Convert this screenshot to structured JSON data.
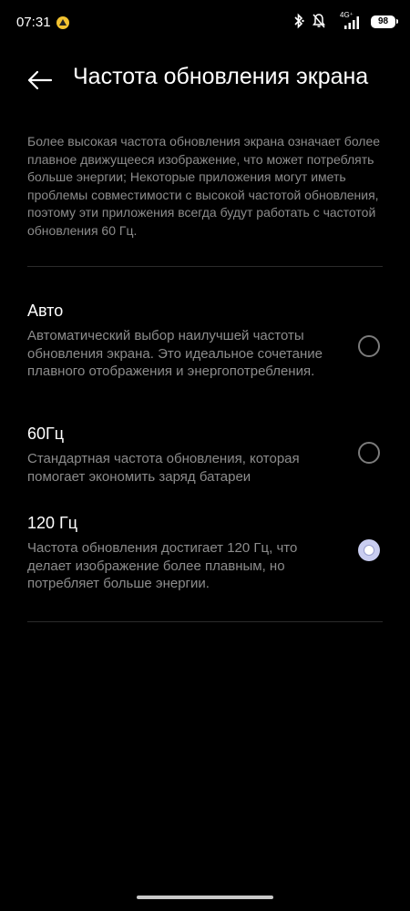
{
  "status_bar": {
    "time": "07:31",
    "network_type": "4G⁺",
    "battery": "98",
    "icons": [
      "app-notification-icon",
      "bluetooth-icon",
      "notifications-off-icon",
      "signal-icon",
      "battery-icon"
    ]
  },
  "header": {
    "back_icon": "back-arrow-icon",
    "title": "Частота обновления экрана"
  },
  "description": "Более высокая частота обновления экрана означает более плавное движущееся изображение, что может потреблять больше энергии; Некоторые приложения могут иметь проблемы совместимости с высокой частотой обновления, поэтому эти приложения всегда будут работать с частотой обновления 60 Гц.",
  "options": [
    {
      "title": "Авто",
      "desc": "Автоматический выбор наилучшей частоты обновления экрана. Это идеальное сочетание плавного отображения и энергопотребления.",
      "selected": false
    },
    {
      "title": "60Гц",
      "desc": "Стандартная частота обновления, которая помогает экономить заряд батареи",
      "selected": false
    },
    {
      "title": "120 Гц",
      "desc": "Частота обновления достигает 120 Гц, что делает изображение более плавным, но потребляет больше энергии.",
      "selected": true
    }
  ],
  "colors": {
    "background": "#000000",
    "primary_text": "#ffffff",
    "secondary_text": "#8c8c8c",
    "radio_selected": "#c9cdf0"
  }
}
